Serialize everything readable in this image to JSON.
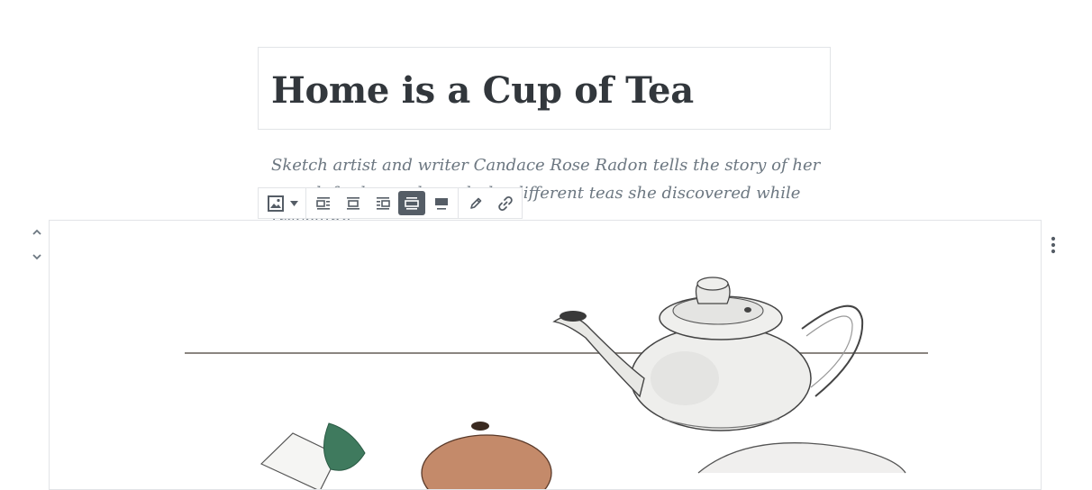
{
  "post": {
    "title": "Home is a Cup of Tea",
    "subtitle": "Sketch artist and writer Candace Rose Radon tells the story of her search for home through the different teas she discovered while travelling"
  },
  "toolbar": {
    "block_type": "image-icon",
    "alignments": [
      "align-left-icon",
      "align-center-icon",
      "align-right-icon",
      "align-wide-icon",
      "align-full-icon"
    ],
    "active_alignment": "align-wide",
    "actions": [
      "edit-icon",
      "link-icon"
    ]
  },
  "block_movers": [
    "chevron-up-icon",
    "chevron-down-icon"
  ],
  "block_menu": "more-vertical-icon",
  "colors": {
    "text": "#32373c",
    "subtitle": "#6c7781",
    "border": "#e2e4e7",
    "toolbar_active": "#555d66"
  }
}
